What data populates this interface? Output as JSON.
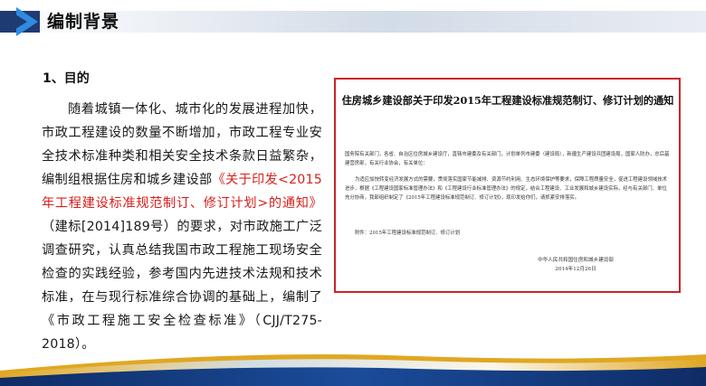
{
  "header": {
    "title": "编制背景"
  },
  "content": {
    "section_heading": "1、目的",
    "para_part1": "随着城镇一体化、城市化的发展进程加快，市政工程建设的数量不断增加，市政工程专业安全技术标准种类和相关安全技术条款日益繁杂，编制组根据住房和城乡建设部",
    "para_red": "《关于印发<2015年工程建设标准规范制订、修订计划>的通知》",
    "para_part2": "（建标[2014]189号）的要求，对市政施工广泛调查研究，认真总结我国市政工程施工现场安全检查的实践经验，参考国内先进技术法规和技术标准，在与现行标准综合协调的基础上，编制了《市政工程施工安全检查标准》（CJJ/T275-2018）。"
  },
  "notice": {
    "title": "住房城乡建设部关于印发2015年工程建设标准规范制订、修订计划的通知",
    "p1": "国务院有关部门，各省、自治区住房城乡建设厅，直辖市建委及有关部门，计划单列市建委（建设局），新疆生产建设兵团建设局，国家人防办，总后基建营房部，有关行业协会，有关单位：",
    "p2": "为适应加快转变经济发展方式的需要，贯彻落实国家节能减排、资源节约利用、生态环境保护等要求，保障工程质量安全，促进工程建设领域技术进步，根据《工程建设国家标准管理办法》和《工程建设行业标准管理办法》的规定，结合工程建设、工业发展和城乡建设实际，经与有关部门、单位充分协商，我部组织制定了《2015年工程建设标准规范制订、修订计划》，现印发给你们，请抓紧安排落实。",
    "p3": "附件：2015年工程建设标准规范制订、修订计划",
    "signer": "中华人民共和国住房和城乡建设部",
    "date": "2014年12月26日"
  },
  "colors": {
    "accent_blue": "#2e8be0",
    "dark_blue": "#1f3b73",
    "highlight_red": "#d8201c",
    "frame_red": "#c8252b",
    "gold": "#e0a722"
  },
  "icons": {
    "header_marker": "chevron-arrow-icon"
  }
}
